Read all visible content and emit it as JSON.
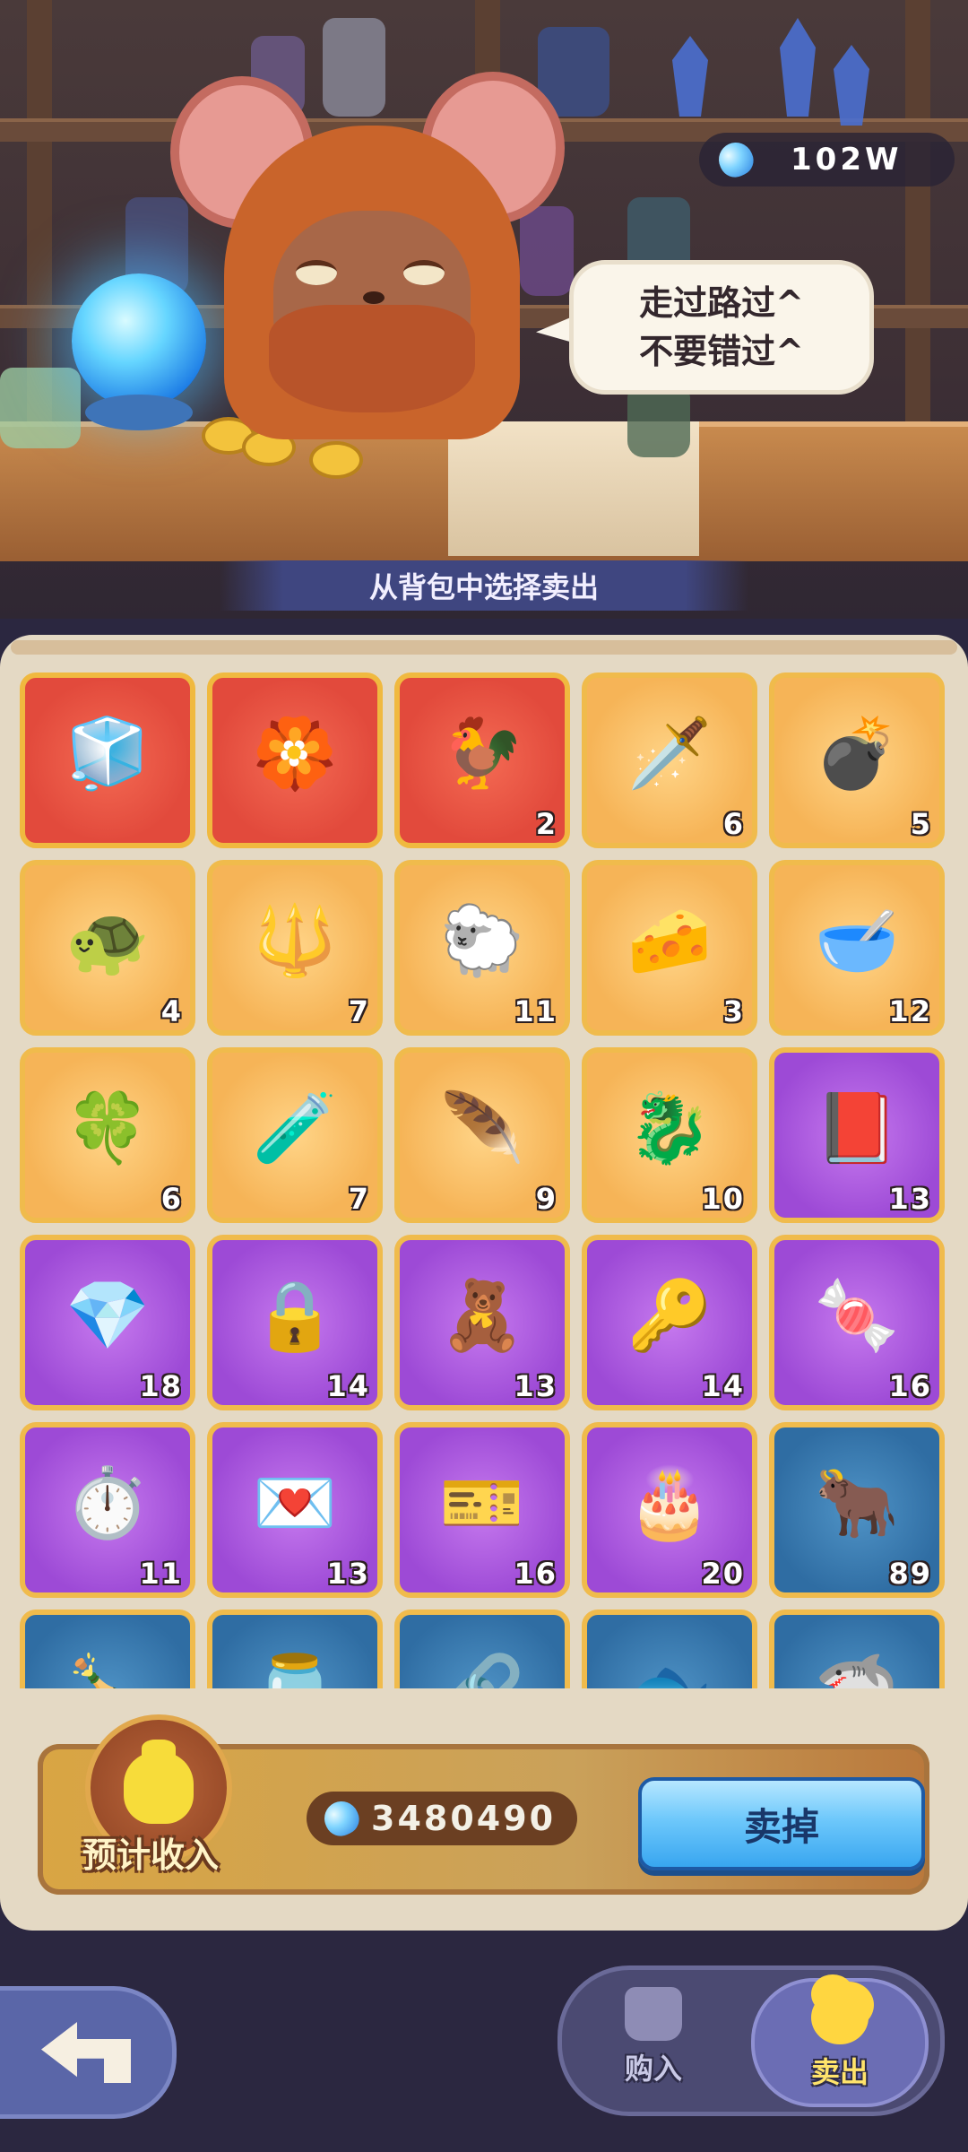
{
  "header": {
    "currency_value": "102W",
    "speech_line1": "走过路过^",
    "speech_line2": "不要错过^",
    "banner": "从背包中选择卖出"
  },
  "inventory": [
    {
      "name": "ice-cube-icon",
      "emoji": "🧊",
      "rarity": "red",
      "count": ""
    },
    {
      "name": "golden-wheel-icon",
      "emoji": "🏵️",
      "rarity": "red",
      "count": ""
    },
    {
      "name": "chicken-icon",
      "emoji": "🐓",
      "rarity": "red",
      "count": "2"
    },
    {
      "name": "dagger-icon",
      "emoji": "🗡️",
      "rarity": "gold",
      "count": "6"
    },
    {
      "name": "cannon-icon",
      "emoji": "💣",
      "rarity": "gold",
      "count": "5"
    },
    {
      "name": "terrarium-icon",
      "emoji": "🐢",
      "rarity": "gold",
      "count": "4"
    },
    {
      "name": "fork-icon",
      "emoji": "🔱",
      "rarity": "gold",
      "count": "7"
    },
    {
      "name": "golden-sheep-icon",
      "emoji": "🐑",
      "rarity": "gold",
      "count": "11"
    },
    {
      "name": "cheese-icon",
      "emoji": "🧀",
      "rarity": "gold",
      "count": "3"
    },
    {
      "name": "golden-bowl-icon",
      "emoji": "🥣",
      "rarity": "gold",
      "count": "12"
    },
    {
      "name": "clover-coin-icon",
      "emoji": "🍀",
      "rarity": "gold",
      "count": "6"
    },
    {
      "name": "potion-bottle-icon",
      "emoji": "🧪",
      "rarity": "gold",
      "count": "7"
    },
    {
      "name": "golden-feather-icon",
      "emoji": "🪶",
      "rarity": "gold",
      "count": "9"
    },
    {
      "name": "golden-dragon-icon",
      "emoji": "🐉",
      "rarity": "gold",
      "count": "10"
    },
    {
      "name": "red-book-icon",
      "emoji": "📕",
      "rarity": "purple",
      "count": "13"
    },
    {
      "name": "gem-icon",
      "emoji": "💎",
      "rarity": "purple",
      "count": "18"
    },
    {
      "name": "chain-lock-icon",
      "emoji": "🔒",
      "rarity": "purple",
      "count": "14"
    },
    {
      "name": "teddy-bear-icon",
      "emoji": "🧸",
      "rarity": "purple",
      "count": "13"
    },
    {
      "name": "key-icon",
      "emoji": "🔑",
      "rarity": "purple",
      "count": "14"
    },
    {
      "name": "candy-icon",
      "emoji": "🍬",
      "rarity": "purple",
      "count": "16"
    },
    {
      "name": "stopwatch-icon",
      "emoji": "⏱️",
      "rarity": "purple",
      "count": "11"
    },
    {
      "name": "love-letter-icon",
      "emoji": "💌",
      "rarity": "purple",
      "count": "13"
    },
    {
      "name": "vip-ticket-icon",
      "emoji": "🎫",
      "rarity": "purple",
      "count": "16"
    },
    {
      "name": "cake-icon",
      "emoji": "🎂",
      "rarity": "purple",
      "count": "20"
    },
    {
      "name": "bull-statue-icon",
      "emoji": "🐂",
      "rarity": "blue",
      "count": "89"
    },
    {
      "name": "message-bottle-icon",
      "emoji": "🍾",
      "rarity": "blue",
      "count": ""
    },
    {
      "name": "glass-bottle-icon",
      "emoji": "🫙",
      "rarity": "blue",
      "count": ""
    },
    {
      "name": "keyring-icon",
      "emoji": "🔗",
      "rarity": "blue",
      "count": ""
    },
    {
      "name": "fish-icon",
      "emoji": "🐟",
      "rarity": "blue",
      "count": ""
    },
    {
      "name": "shark-fin-icon",
      "emoji": "🦈",
      "rarity": "blue",
      "count": ""
    }
  ],
  "income": {
    "label": "预计收入",
    "value": "3480490",
    "sell_button": "卖掉"
  },
  "tabs": {
    "buy": "购入",
    "sell": "卖出"
  },
  "colors": {
    "red_rarity": "#e24a3c",
    "gold_rarity": "#f6b457",
    "purple_rarity": "#9d4ad6",
    "blue_rarity": "#2f6da3",
    "sell_button": "#6ec8fb"
  }
}
